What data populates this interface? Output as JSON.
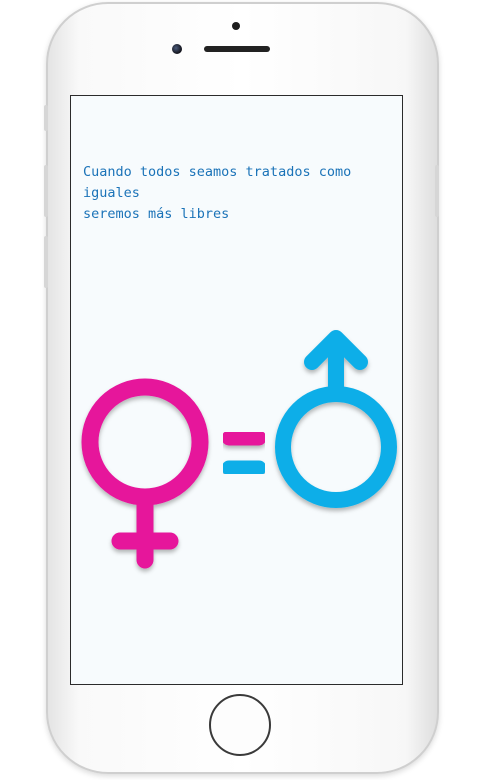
{
  "quote": {
    "line1": "Cuando todos seamos tratados como",
    "line2": "iguales",
    "line3": "seremos más libres"
  },
  "icons": {
    "female": "female-symbol-icon",
    "equals": "equals-sign-icon",
    "male": "male-symbol-icon"
  },
  "colors": {
    "female": "#e6139b",
    "male": "#0aaee8",
    "text": "#1b73b8",
    "screen": "#f7fbfd"
  }
}
